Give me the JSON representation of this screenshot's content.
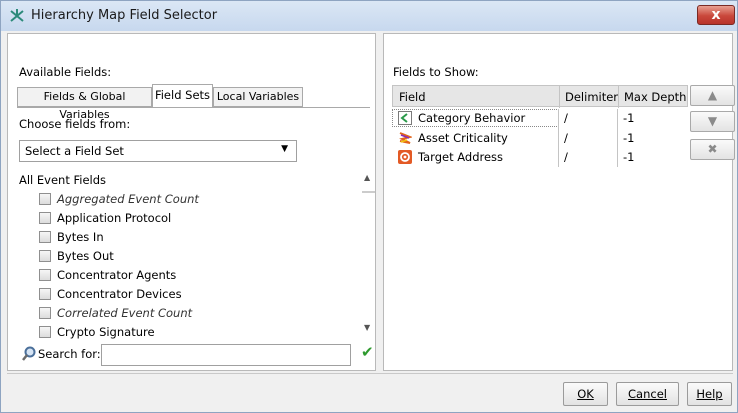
{
  "window": {
    "title": "Hierarchy Map Field Selector",
    "close_label": "x"
  },
  "left": {
    "available_label": "Available Fields:",
    "tabs": [
      {
        "label": "Fields & Global Variables"
      },
      {
        "label": "Field Sets"
      },
      {
        "label": "Local Variables"
      }
    ],
    "choose_label": "Choose fields from:",
    "select_value": "Select a Field Set",
    "list_header": "All Event Fields",
    "fields": [
      {
        "label": "Aggregated Event Count",
        "italic": true
      },
      {
        "label": "Application Protocol",
        "italic": false
      },
      {
        "label": "Bytes In",
        "italic": false
      },
      {
        "label": "Bytes Out",
        "italic": false
      },
      {
        "label": "Concentrator Agents",
        "italic": false
      },
      {
        "label": "Concentrator Devices",
        "italic": false
      },
      {
        "label": "Correlated Event Count",
        "italic": true
      },
      {
        "label": "Crypto Signature",
        "italic": false
      }
    ],
    "search_label": "Search for:",
    "search_value": ""
  },
  "right": {
    "fields_label": "Fields to Show:",
    "columns": [
      "Field",
      "Delimiter",
      "Max Depth"
    ],
    "rows": [
      {
        "icon": "category-behavior-icon",
        "field": "Category Behavior",
        "delimiter": "/",
        "max_depth": "-1"
      },
      {
        "icon": "asset-criticality-icon",
        "field": "Asset Criticality",
        "delimiter": "/",
        "max_depth": "-1"
      },
      {
        "icon": "target-address-icon",
        "field": "Target Address",
        "delimiter": "/",
        "max_depth": "-1"
      }
    ],
    "side_buttons": {
      "up": "▲",
      "down": "▼",
      "remove": "✖"
    }
  },
  "footer": {
    "ok": "OK",
    "cancel": "Cancel",
    "help": "Help"
  },
  "colors": {
    "title_bar": "#c7d8ee",
    "close": "#c9473b",
    "accent": "#2e9a2e"
  }
}
